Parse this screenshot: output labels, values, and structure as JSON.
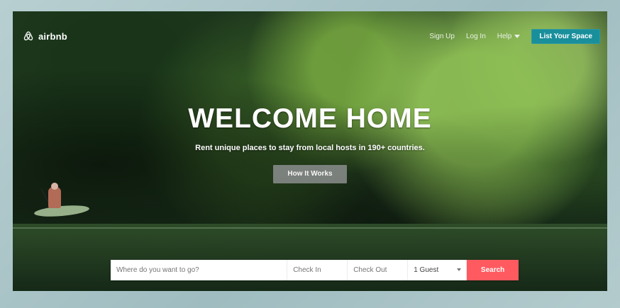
{
  "header": {
    "brand_name": "airbnb",
    "nav": {
      "sign_up": "Sign Up",
      "log_in": "Log In",
      "help": "Help",
      "list_space": "List Your Space"
    }
  },
  "hero": {
    "title": "WELCOME HOME",
    "subtitle": "Rent unique places to stay from local hosts in 190+ countries.",
    "button": "How It Works"
  },
  "search": {
    "destination_placeholder": "Where do you want to go?",
    "checkin_placeholder": "Check In",
    "checkout_placeholder": "Check Out",
    "guests_selected": "1 Guest",
    "submit": "Search"
  },
  "colors": {
    "primary_button": "#1a8f9c",
    "search_button": "#ff5a5f"
  },
  "icons": {
    "logo": "airbnb-logo-icon",
    "help_chevron": "chevron-down-icon",
    "guests_chevron": "chevron-down-icon"
  }
}
